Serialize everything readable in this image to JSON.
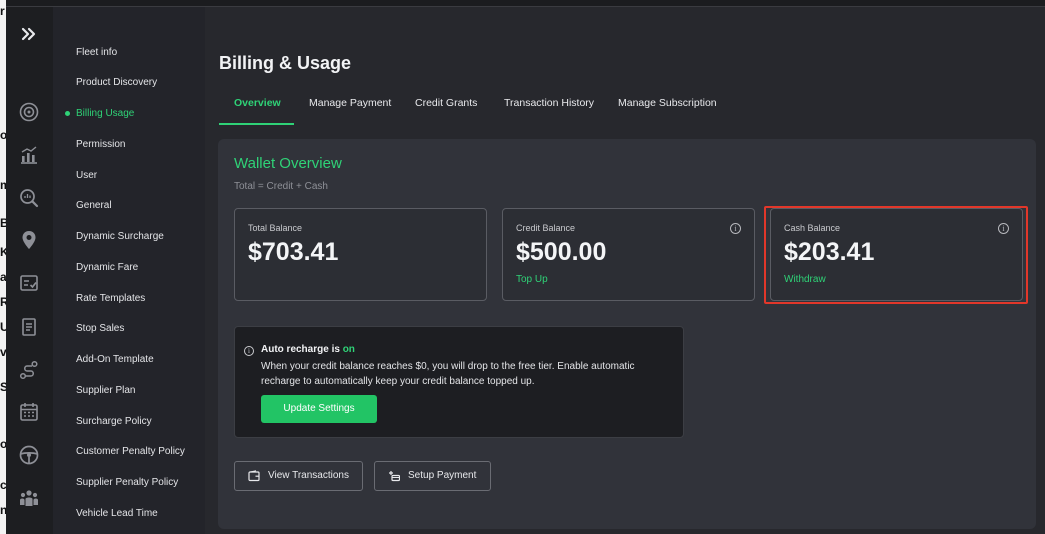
{
  "edge_fragments": [
    "r",
    "o",
    "m",
    "B",
    "K",
    "a",
    "R",
    "U",
    "v",
    "S",
    "o",
    "c",
    "n"
  ],
  "rail": {
    "expand_icon": "double-chevron-right-icon",
    "icons": [
      "target-icon",
      "analytics-icon",
      "search-chart-icon",
      "map-pin-icon",
      "checklist-icon",
      "document-icon",
      "route-icon",
      "calendar-icon",
      "steering-wheel-icon",
      "group-icon"
    ]
  },
  "sidebar": {
    "items": [
      {
        "label": "Fleet info"
      },
      {
        "label": "Product Discovery"
      },
      {
        "label": "Billing Usage"
      },
      {
        "label": "Permission"
      },
      {
        "label": "User"
      },
      {
        "label": "General"
      },
      {
        "label": "Dynamic Surcharge"
      },
      {
        "label": "Dynamic Fare"
      },
      {
        "label": "Rate Templates"
      },
      {
        "label": "Stop Sales"
      },
      {
        "label": "Add-On Template"
      },
      {
        "label": "Supplier Plan"
      },
      {
        "label": "Surcharge Policy"
      },
      {
        "label": "Customer Penalty Policy"
      },
      {
        "label": "Supplier Penalty Policy"
      },
      {
        "label": "Vehicle Lead Time"
      }
    ],
    "active_index": 2
  },
  "page": {
    "title": "Billing & Usage",
    "tabs": [
      "Overview",
      "Manage Payment",
      "Credit Grants",
      "Transaction History",
      "Manage Subscription"
    ],
    "active_tab": "Overview"
  },
  "wallet": {
    "title": "Wallet Overview",
    "subtitle": "Total = Credit + Cash",
    "cards": [
      {
        "label": "Total Balance",
        "value": "$703.41",
        "link": ""
      },
      {
        "label": "Credit Balance",
        "value": "$500.00",
        "link": "Top Up"
      },
      {
        "label": "Cash Balance",
        "value": "$203.41",
        "link": "Withdraw"
      }
    ]
  },
  "auto_recharge": {
    "heading_prefix": "Auto recharge is",
    "status": "on",
    "body": "When your credit balance reaches $0, you will drop to the free tier. Enable automatic recharge to automatically keep your credit balance topped up.",
    "button": "Update Settings"
  },
  "actions": {
    "view_transactions": "View Transactions",
    "setup_payment": "Setup Payment"
  },
  "colors": {
    "accent": "#2fd277",
    "highlight": "#e2372a",
    "panel": "#31333a"
  }
}
